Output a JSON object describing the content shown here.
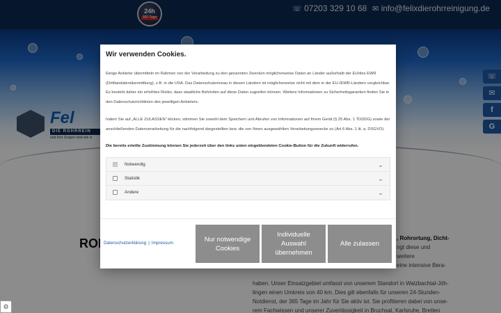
{
  "header": {
    "badge_top": "24h",
    "badge_bottom": "365 Tage",
    "phone_icon": "phone-icon",
    "phone": "07203 329 10 68",
    "mail_icon": "mail-icon",
    "email": "info@felixdierohrreinigung.de"
  },
  "logo": {
    "name": "Fel",
    "sub": "DIE ROHRREIN",
    "tagline": "und Ihre Sorgen sind wie w"
  },
  "side_buttons": [
    "phone-icon",
    "mail-icon",
    "facebook-icon",
    "google-icon"
  ],
  "page": {
    "title": "ROH",
    "body_lines": [
      ", Rohrortung, Dicht-",
      "ngt diese und weitere",
      "eine intensive Bera-",
      "",
      "haben. Unser Einsatzgebiet umfasst von unserem Standort in Walzbachtal-Jöh-",
      "lingen einen Umkreis von 40 km. Dies gilt ebenfalls für unseren 24-Stunden-",
      "Notdienst, der 365 Tage im Jahr für Sie aktiv ist. Sie profitieren dabei von unse-",
      "rem Fachwissen und unserer Zuverlässigkeit in Bruchsal, Karlsruhe, Bretten"
    ]
  },
  "cookie": {
    "title": "Wir verwenden Cookies.",
    "paragraph1": "Einige Anbieter übermitteln im Rahmen von der Verarbeitung zu den genannten Zwecken möglicherweise Daten an Länder außerhalb der EU/des EWR (Drittlandatenübermittlung), z.B. in die USA. Das Datenschutzniveau in diesen Ländern ist möglicherweise nicht mit dem in der EU-/EWR-Ländern vergleichbar. Es besteht daher ein erhöhtes Risiko, dass staatliche Behörden auf diese Daten zugreifen können. Weitere Informationen zu Sicherheitsgarantien finden Sie in den Datenschutzrichtlinien des jeweiligen Anbieters.",
    "paragraph2": "Indem Sie auf „ALLE ZULASSEN“ klicken, stimmen Sie sowohl dem Speichern und Abrufen von Informationen auf Ihrem Gerät (§ 25 Abs. 1 TDDDG) sowie der anschließenden Datenverarbeitung für die nachfolgend dargestellten bzw. die von Ihnen ausgewählten Verarbeitungszwecke zu (Art 6 Abs. 1 lit. a. DSGVO).",
    "consent_note": "Die bereits erteilte Zustimmung können Sie jederzeit über den links unten eingeblendeten Cookie-Button für die Zukunft widerrufen.",
    "categories": [
      {
        "label": "Notwendig",
        "checked": true,
        "disabled": true
      },
      {
        "label": "Statistik",
        "checked": false,
        "disabled": false
      },
      {
        "label": "Andere",
        "checked": false,
        "disabled": false
      }
    ],
    "link_privacy": "Datenschutzerklärung",
    "link_separator": "|",
    "link_imprint": "Impressum",
    "btn_necessary": "Nur notwendige Cookies",
    "btn_individual": "Individuelle Auswahl übernehmen",
    "btn_all": "Alle zulassen"
  },
  "colors": {
    "header_bg": "#0c2a52",
    "accent_blue": "#1e5aa8",
    "button_gray": "#8d8d8d"
  }
}
